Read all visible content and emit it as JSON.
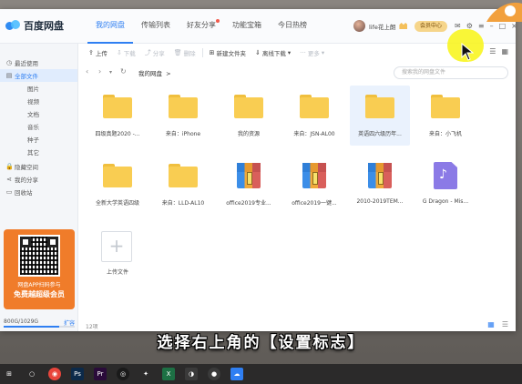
{
  "app": {
    "logo_text": "百度网盘",
    "tabs": [
      {
        "label": "我的网盘",
        "active": true
      },
      {
        "label": "传输列表"
      },
      {
        "label": "好友分享",
        "dot": true
      },
      {
        "label": "功能宝箱"
      },
      {
        "label": "今日热榜"
      }
    ],
    "user": {
      "name": "life花上朗",
      "member_button": "会员中心"
    }
  },
  "sidebar": {
    "items": [
      {
        "label": "最近使用",
        "icon": "clock-icon"
      },
      {
        "label": "全部文件",
        "icon": "files-icon",
        "active": true
      },
      {
        "label": "图片",
        "sub": true
      },
      {
        "label": "视频",
        "sub": true
      },
      {
        "label": "文档",
        "sub": true
      },
      {
        "label": "音乐",
        "sub": true
      },
      {
        "label": "种子",
        "sub": true
      },
      {
        "label": "其它",
        "sub": true
      },
      {
        "label": "隐藏空间",
        "icon": "lock-icon"
      },
      {
        "label": "我的分享",
        "icon": "share-icon"
      },
      {
        "label": "回收站",
        "icon": "trash-icon"
      }
    ],
    "promo": {
      "line1": "网盘APP扫码参与",
      "line2": "免费越超级会员"
    },
    "storage": {
      "text": "800G/1029G",
      "expand": "扩容",
      "used_fraction": 0.78
    }
  },
  "toolbar": {
    "upload": "上传",
    "download": "下载",
    "share": "分享",
    "delete": "删除",
    "new_folder": "新建文件夹",
    "offline": "离线下载",
    "more": "更多"
  },
  "address": {
    "crumb": "我的网盘",
    "crumb_arrow": ">",
    "search_placeholder": "搜索我的网盘文件"
  },
  "files": [
    {
      "name": "四级真题2020 -...",
      "type": "folder"
    },
    {
      "name": "来自：iPhone",
      "type": "folder"
    },
    {
      "name": "我的资源",
      "type": "folder"
    },
    {
      "name": "来自：JSN-AL00",
      "type": "folder"
    },
    {
      "name": "英语四六级历年...",
      "type": "folder",
      "selected": true
    },
    {
      "name": "来自：小飞机",
      "type": "folder"
    },
    {
      "name": "全新大学英语四级",
      "type": "folder"
    },
    {
      "name": "来自：LLD-AL10",
      "type": "folder"
    },
    {
      "name": "office2019专业...",
      "type": "zip"
    },
    {
      "name": "office2019一键...",
      "type": "zip"
    },
    {
      "name": "2010-2019TEM...",
      "type": "zip"
    },
    {
      "name": "G Dragon - Mis...",
      "type": "music"
    },
    {
      "name": "上传文件",
      "type": "upload"
    }
  ],
  "status": {
    "count": "12项"
  },
  "subtitle": "选择右上角的【设置标志】",
  "taskbar": [
    "windows-icon",
    "search-icon",
    "chrome-icon",
    "photoshop-icon",
    "premiere-icon",
    "obs-icon",
    "app-icon",
    "excel-icon",
    "media-icon",
    "record-icon",
    "baidu-netdisk-icon"
  ]
}
